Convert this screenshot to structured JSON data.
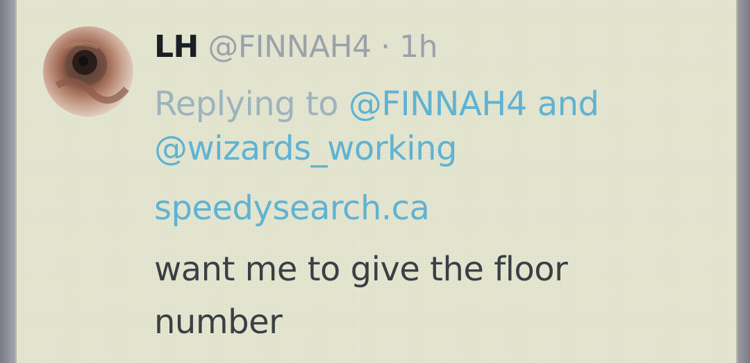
{
  "tweet": {
    "display_name": "LH",
    "handle": "@FINNAH4",
    "separator": "·",
    "time": "1h",
    "reply_prefix": "Replying to",
    "reply_mentions": [
      "@FINNAH4",
      "@wizards_working"
    ],
    "reply_and": "and",
    "link": "speedysearch.ca",
    "text_lines": [
      "want me to give the floor",
      "number"
    ]
  },
  "avatar": {
    "icon": "profile-avatar"
  }
}
